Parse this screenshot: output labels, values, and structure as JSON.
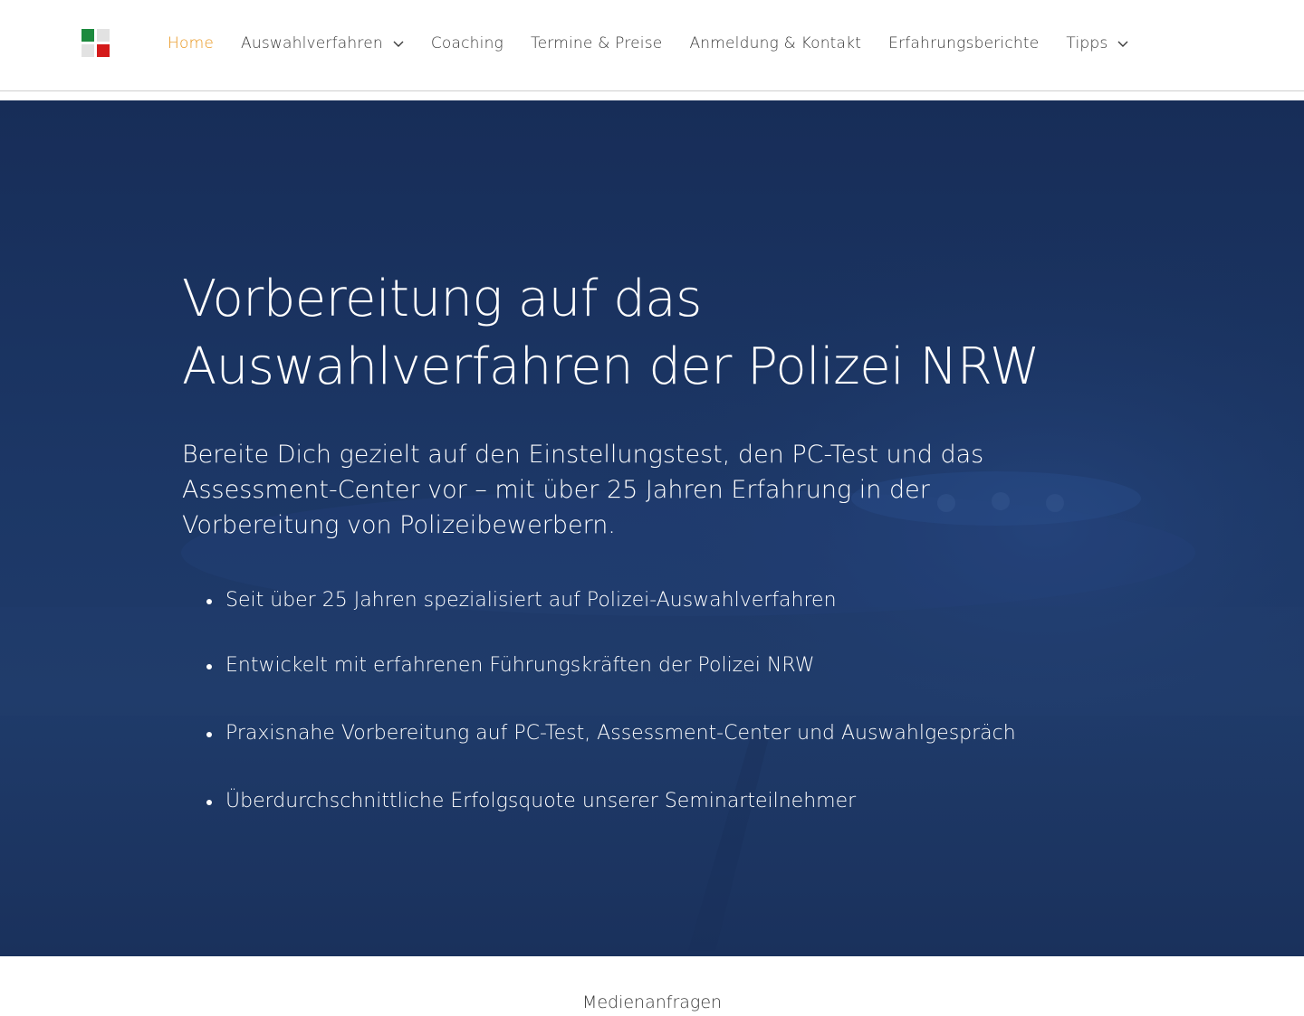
{
  "brand": {
    "colors": {
      "logo_green": "#1d8a3e",
      "logo_grey": "#e2e2e2",
      "logo_red": "#d41a1a",
      "nav_active": "#e8951c",
      "nav_text": "#3a3a3a",
      "hero_bg": "#1c3460"
    }
  },
  "nav": {
    "items": [
      {
        "label": "Home",
        "active": true
      },
      {
        "label": "Auswahlverfahren",
        "has_dropdown": true,
        "icon": "chevron-down-icon"
      },
      {
        "label": "Coaching"
      },
      {
        "label": "Termine & Preise"
      },
      {
        "label": "Anmeldung & Kontakt"
      },
      {
        "label": "Erfahrungsberichte"
      },
      {
        "label": "Tipps",
        "has_dropdown": true,
        "icon": "chevron-down-icon"
      }
    ]
  },
  "hero": {
    "title_line1": "Vorbereitung auf das",
    "title_line2": "Auswahlverfahren der Polizei NRW",
    "subtitle": "Bereite Dich gezielt auf den Einstellungstest, den PC-Test und das Assessment-Center vor – mit über 25 Jahren Erfahrung in der Vorbereitung von Polizeibewerbern.",
    "bullets": [
      "Seit über 25 Jahren spezialisiert auf Polizei-Auswahlverfahren",
      "Entwickelt mit erfahrenen Führungskräften der Polizei NRW",
      "Praxisnahe Vorbereitung auf PC-Test, Assessment-Center und Auswahlgespräch",
      "Überdurchschnittliche Erfolgsquote unserer Seminarteilnehmer"
    ]
  },
  "footer": {
    "media_link": "Medienanfragen"
  }
}
